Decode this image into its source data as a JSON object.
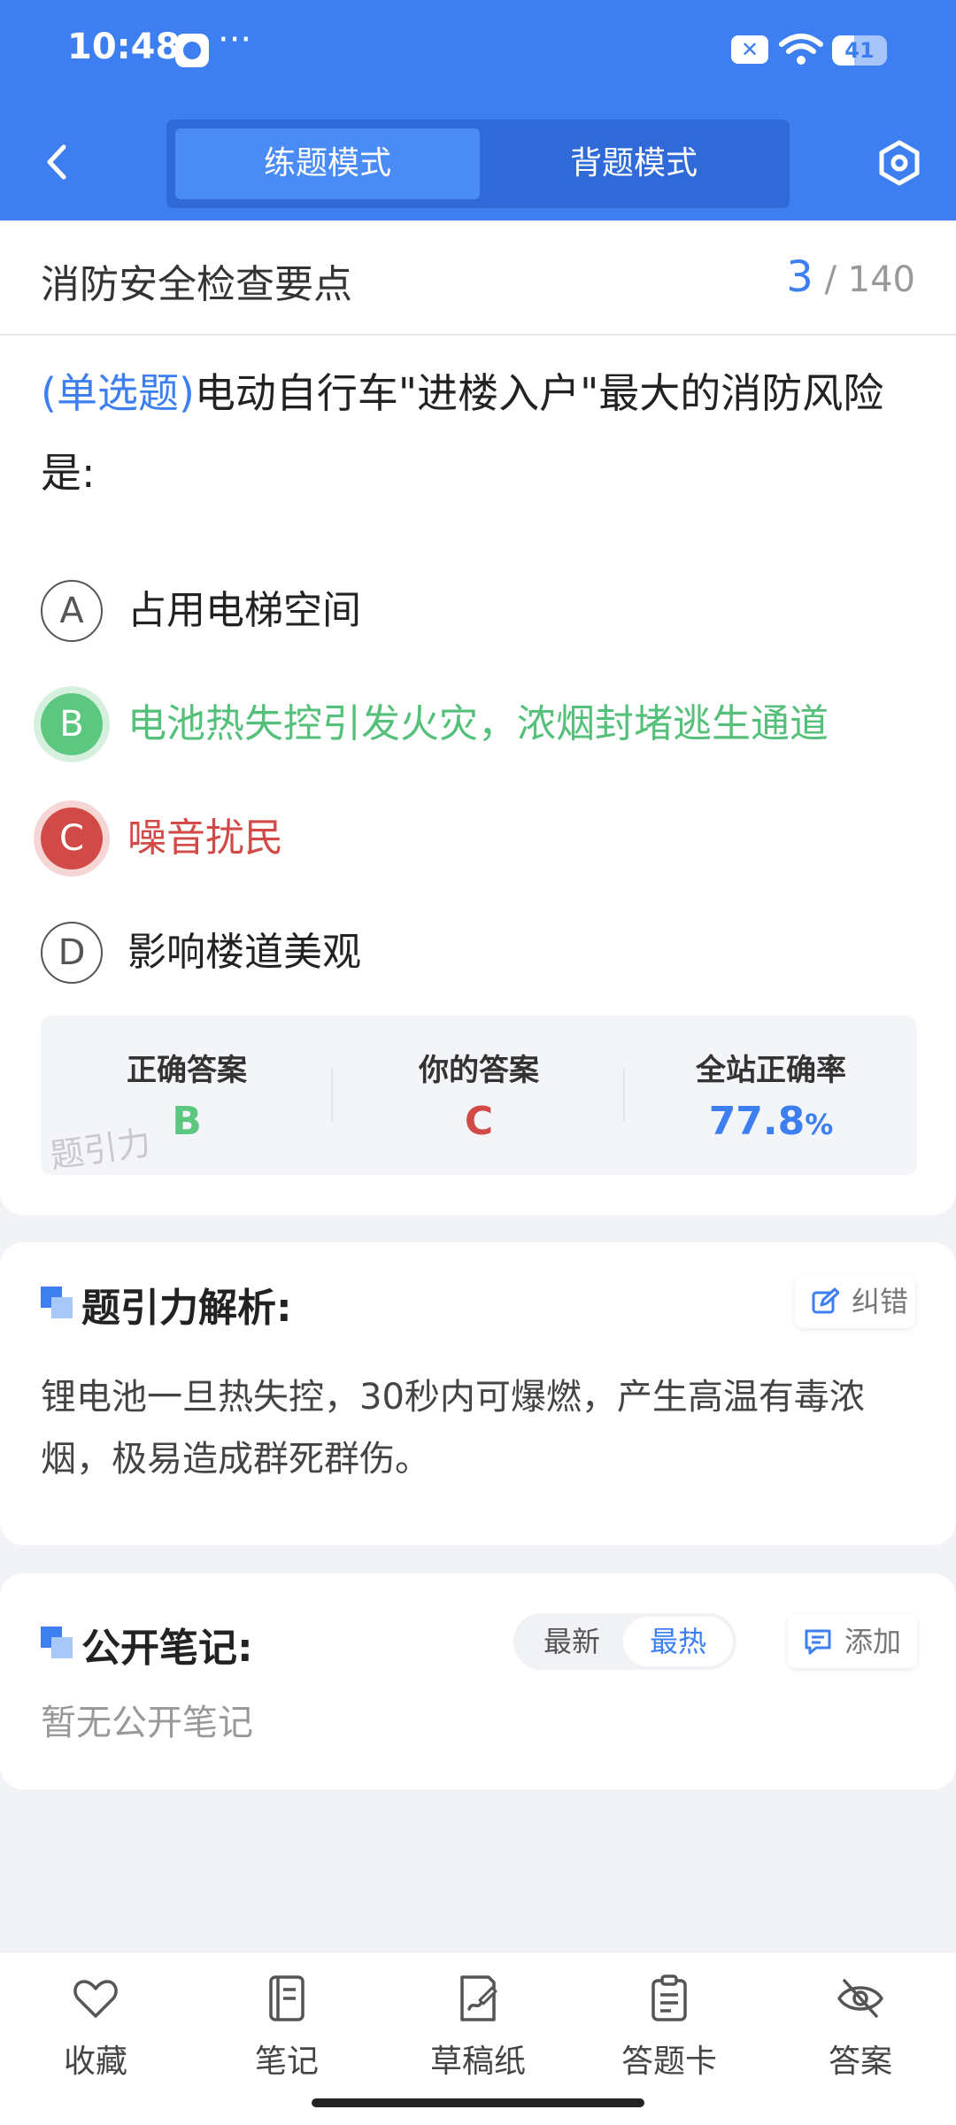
{
  "status_bar": {
    "time": "10:48",
    "more": "···",
    "battery_level": "41",
    "battery_percent": 41
  },
  "header": {
    "modes": [
      {
        "label": "练题模式",
        "active": true
      },
      {
        "label": "背题模式",
        "active": false
      }
    ]
  },
  "chapter": {
    "title": "消防安全检查要点",
    "current": "3",
    "total": "/ 140"
  },
  "question": {
    "type_label": "(单选题)",
    "text": "电动自行车\"进楼入户\"最大的消防风险是:",
    "options": [
      {
        "letter": "A",
        "text": "占用电梯空间",
        "state": "normal"
      },
      {
        "letter": "B",
        "text": "电池热失控引发火灾，浓烟封堵逃生通道",
        "state": "correct"
      },
      {
        "letter": "C",
        "text": "噪音扰民",
        "state": "wrong"
      },
      {
        "letter": "D",
        "text": "影响楼道美观",
        "state": "normal"
      }
    ]
  },
  "answers": {
    "correct_label": "正确答案",
    "correct_value": "B",
    "yours_label": "你的答案",
    "yours_value": "C",
    "rate_label": "全站正确率",
    "rate_value": "77.8",
    "rate_unit": "%",
    "watermark": "题引力"
  },
  "analysis": {
    "title": "题引力解析:",
    "report_label": "纠错",
    "text": "锂电池一旦热失控，30秒内可爆燃，产生高温有毒浓烟，极易造成群死群伤。"
  },
  "notes": {
    "title": "公开笔记:",
    "sort_newest": "最新",
    "sort_hottest": "最热",
    "add_label": "添加",
    "empty_text": "暂无公开笔记"
  },
  "bottom_nav": [
    {
      "label": "收藏",
      "icon": "heart-icon"
    },
    {
      "label": "笔记",
      "icon": "notebook-icon"
    },
    {
      "label": "草稿纸",
      "icon": "draft-icon"
    },
    {
      "label": "答题卡",
      "icon": "answer-sheet-icon"
    },
    {
      "label": "答案",
      "icon": "eye-off-icon"
    }
  ],
  "colors": {
    "primary": "#3d7ff0",
    "correct": "#5cc77e",
    "wrong": "#d24a47"
  }
}
